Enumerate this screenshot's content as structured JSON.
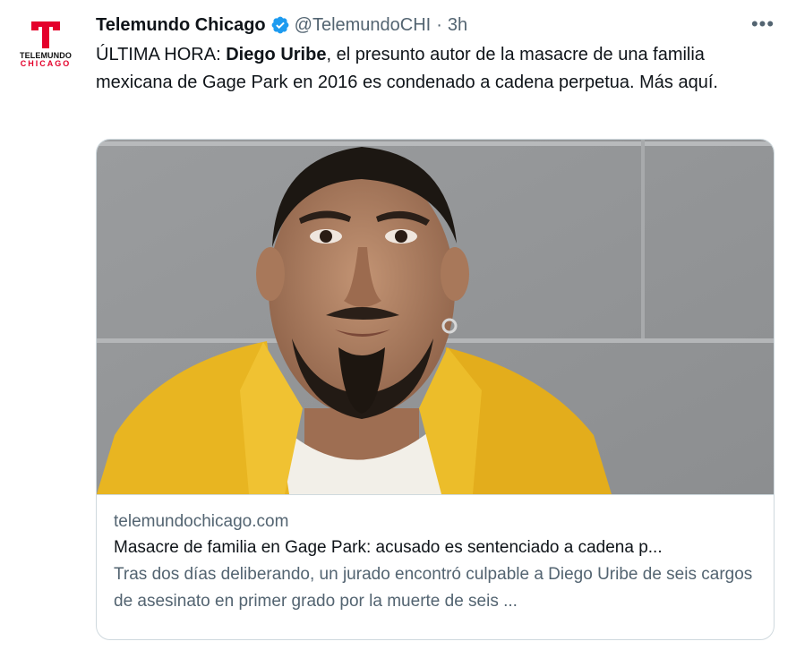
{
  "author": {
    "display_name": "Telemundo Chicago",
    "handle": "@TelemundoCHI",
    "separator": "·",
    "time": "3h",
    "avatar_logo_top": "TELEMUNDO",
    "avatar_logo_bottom": "CHICAGO",
    "verified_icon": "verified-badge-icon"
  },
  "more_label": "•••",
  "tweet": {
    "text_before": "ÚLTIMA HORA: ",
    "text_bold": "Diego Uribe",
    "text_after": ", el presunto autor de la masacre de una familia mexicana de Gage Park en 2016 es condenado a cadena perpetua. Más aquí."
  },
  "card": {
    "domain": "telemundochicago.com",
    "title": "Masacre de familia en Gage Park: acusado es sentenciado a cadena p...",
    "description": "Tras dos días deliberando, un jurado encontró culpable a Diego Uribe de seis cargos de asesinato en primer grado por la muerte de seis ..."
  },
  "colors": {
    "brand_red": "#e4002b",
    "verified_blue": "#1d9bf0",
    "secondary_text": "#536471",
    "border": "#cfd9de"
  }
}
